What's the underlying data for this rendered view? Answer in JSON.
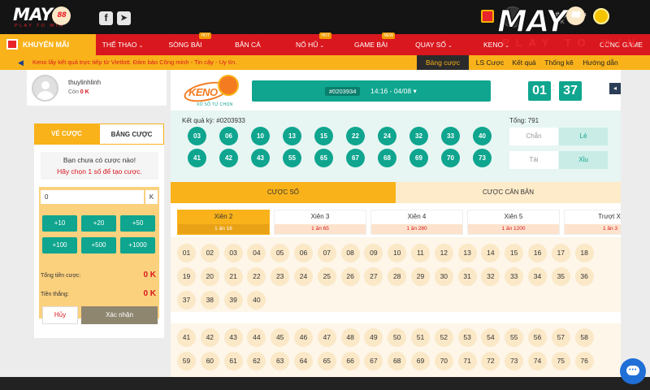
{
  "brand": {
    "name_a": "MAY",
    "name_b": "88",
    "tagline": "PLAY TO WIN"
  },
  "header": {
    "facebook_icon": "facebook-icon",
    "telegram_icon": "telegram-icon",
    "username": "thuylinhlinh",
    "balance": "0 K"
  },
  "nav": {
    "promo": "KHUYẾN MÃI",
    "items": [
      {
        "label": "THỂ THAO",
        "caret": "⌄",
        "badge": ""
      },
      {
        "label": "SÒNG BÀI",
        "caret": "",
        "badge": "HOT"
      },
      {
        "label": "BẮN CÁ",
        "caret": "",
        "badge": ""
      },
      {
        "label": "NỔ HŨ",
        "caret": "⌄",
        "badge": "HOT"
      },
      {
        "label": "GAME BÀI",
        "caret": "",
        "badge": "NEW"
      },
      {
        "label": "QUAY SỐ",
        "caret": "⌄",
        "badge": ""
      },
      {
        "label": "KENO",
        "caret": "⌄",
        "badge": ""
      },
      {
        "label": "CỔNG GAME",
        "caret": "",
        "badge": ""
      }
    ]
  },
  "ticker": {
    "message": "Keno lấy kết quả trực tiếp từ Vietlott. Đảm bảo Công minh - Tin cậy - Uy tín.",
    "tabs": [
      "Bảng cược",
      "LS Cược",
      "Kết quả",
      "Thống kê",
      "Hướng dẫn"
    ]
  },
  "profile": {
    "name": "thuylinhlinh",
    "balance_label": "Còn",
    "balance": "0 K"
  },
  "betpanel": {
    "tab_active": "VÉ CƯỢC",
    "tab_other": "BẢNG CƯỢC",
    "note_line1": "Bạn chưa có cược nào!",
    "note_line2": "Hãy chọn 1 số để tạo cược.",
    "amount": "0",
    "amount_unit": "K",
    "chips": [
      "+10",
      "+20",
      "+50",
      "+100",
      "+500",
      "+1000"
    ],
    "total_label": "Tổng tiền cược:",
    "total_value": "0 K",
    "win_label": "Tiền thắng:",
    "win_value": "0 K",
    "cancel": "Hủy",
    "confirm": "Xác nhận"
  },
  "game": {
    "logo_word": "KENO",
    "logo_sub": "XỔ SỐ TỰ CHỌN",
    "draw_id": "#0203934",
    "draw_time": "14:16 - 04/08 ▾",
    "timer_min": "01",
    "timer_sec": "37",
    "timer_sep": ":",
    "result_label": "Kết quả kỳ: #0203933",
    "results": [
      "03",
      "06",
      "10",
      "13",
      "15",
      "22",
      "24",
      "32",
      "33",
      "40",
      "41",
      "42",
      "43",
      "55",
      "65",
      "67",
      "68",
      "69",
      "70",
      "73"
    ],
    "total_label": "Tổng: 791",
    "chan": "Chẵn",
    "le": "Lẻ",
    "tai": "Tài",
    "xiu": "Xỉu",
    "tab_so": "CƯỢC SỐ",
    "tab_can": "CƯỢC CĂN BẢN",
    "xien": [
      {
        "name": "Xiên 2",
        "rate": "1 ăn 16"
      },
      {
        "name": "Xiên 3",
        "rate": "1 ăn 65"
      },
      {
        "name": "Xiên 4",
        "rate": "1 ăn 280"
      },
      {
        "name": "Xiên 5",
        "rate": "1 ăn 1200"
      },
      {
        "name": "Trượt Xi",
        "rate": "1 ăn 3"
      }
    ]
  },
  "colors": {
    "brand_red": "#d9171e",
    "accent_yellow": "#f9b21a",
    "teal": "#0fa58f"
  }
}
